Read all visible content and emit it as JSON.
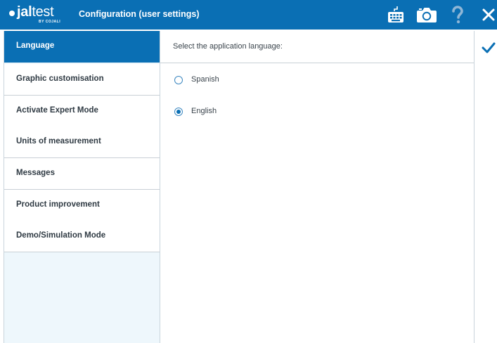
{
  "header": {
    "logo_text_light": "jal",
    "logo_text_regular": "test",
    "logo_sub": "BY COJALI",
    "title": "Configuration (user settings)",
    "icons": [
      "keyboard-icon",
      "camera-icon",
      "help-icon",
      "close-icon"
    ]
  },
  "sidebar": {
    "items": [
      {
        "label": "Language",
        "active": true
      },
      {
        "label": "Graphic customisation",
        "active": false
      },
      {
        "label": "Activate Expert Mode",
        "active": false
      },
      {
        "label": "Units of measurement",
        "active": false
      },
      {
        "label": "Messages",
        "active": false
      },
      {
        "label": "Product improvement",
        "active": false
      },
      {
        "label": "Demo/Simulation Mode",
        "active": false
      }
    ]
  },
  "main": {
    "prompt": "Select the application language:",
    "options": [
      {
        "label": "Spanish",
        "selected": false
      },
      {
        "label": "English",
        "selected": true
      }
    ]
  },
  "actions": {
    "confirm_icon": "checkmark-icon"
  },
  "colors": {
    "accent": "#0a6fb4",
    "sidebar_bg": "#eef7fc",
    "text": "#2f3a43"
  }
}
